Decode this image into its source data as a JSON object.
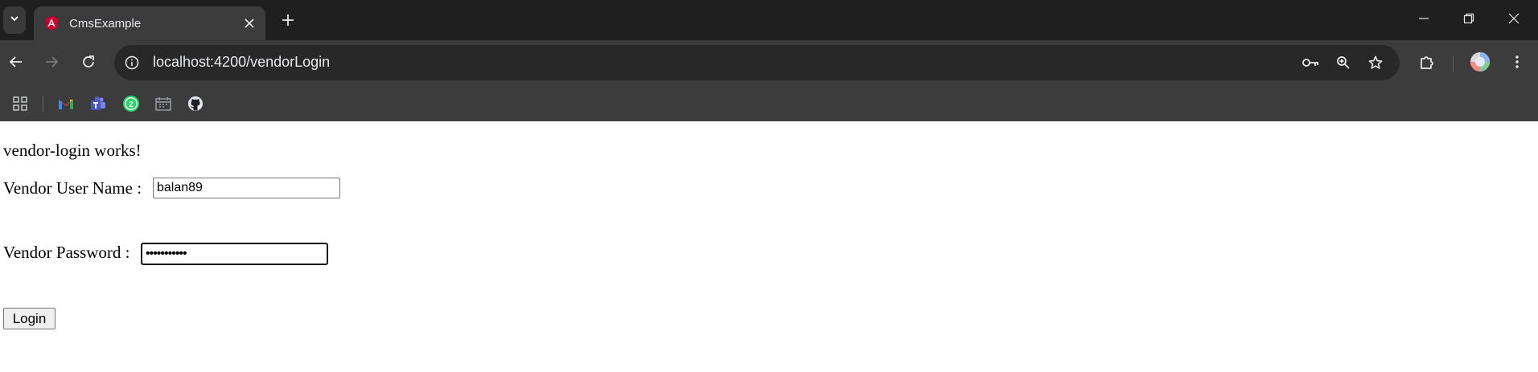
{
  "browser": {
    "tab": {
      "title": "CmsExample"
    },
    "address": {
      "host": "localhost:4200/vendorLogin"
    },
    "icons": {
      "tab_search": "chevron-down-icon",
      "favicon": "angular-icon",
      "close": "close-icon",
      "new_tab": "plus-icon",
      "minimize": "minimize-icon",
      "restore": "restore-icon",
      "close_window": "close-icon",
      "back": "back-arrow-icon",
      "forward": "forward-arrow-icon",
      "reload": "reload-icon",
      "site_info": "info-icon",
      "password": "key-icon",
      "zoom": "zoom-icon",
      "bookmark": "star-icon",
      "extensions": "puzzle-icon",
      "profile": "avatar",
      "menu": "kebab-menu-icon"
    },
    "bookmarks": [
      {
        "name": "apps-icon"
      },
      {
        "name": "gmail-icon"
      },
      {
        "name": "teams-icon"
      },
      {
        "name": "whatsapp-icon",
        "badge": "2"
      },
      {
        "name": "calendar-icon"
      },
      {
        "name": "github-icon"
      }
    ]
  },
  "page": {
    "heading": "vendor-login works!",
    "username": {
      "label": "Vendor User Name :",
      "value": "balan89"
    },
    "password": {
      "label": "Vendor Password :",
      "value": "•••••••••••"
    },
    "login_button": "Login"
  },
  "colors": {
    "tabstrip_bg": "#1f1f1f",
    "toolbar_bg": "#3c3c3c",
    "omnibox_bg": "#282828",
    "icon": "#e8eaed",
    "whatsapp": "#25d366",
    "teams": "#5b5fc7"
  }
}
